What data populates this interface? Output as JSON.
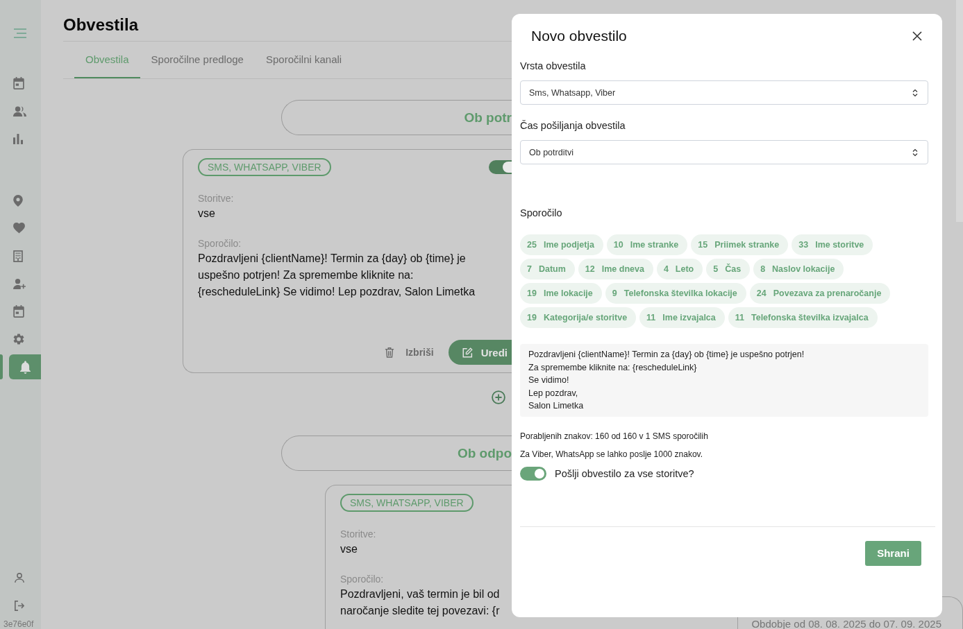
{
  "sidebar": {
    "groups": [
      {
        "items": [
          {
            "selected": false
          },
          {
            "selected": false
          },
          {
            "selected": false
          }
        ]
      },
      {
        "items": [
          {
            "selected": false
          },
          {
            "selected": false
          },
          {
            "selected": false
          },
          {
            "selected": false
          },
          {
            "selected": false
          },
          {
            "selected": false
          },
          {
            "selected": true
          }
        ]
      }
    ],
    "version": "3e76e0f"
  },
  "page": {
    "title": "Obvestila",
    "tabs": [
      {
        "label": "Obvestila",
        "selected": true
      },
      {
        "label": "Sporočilne predloge",
        "selected": false
      },
      {
        "label": "Sporočilni kanali",
        "selected": false
      }
    ]
  },
  "timeline": [
    {
      "heading": "Ob potr",
      "notifications": [
        {
          "channels": "SMS, WHATSAPP, VIBER",
          "enabled": true,
          "services_label": "Storitve:",
          "services": "vse",
          "message_label": "Sporočilo:",
          "message": "Pozdravljeni {clientName}! Termin za {day} ob {time} je uspešno potrjen! Za spremembe kliknite na: {rescheduleLink} Se vidimo! Lep pozdrav, Salon Limetka",
          "actions": {
            "delete": "Izbriši",
            "edit": "Uredi"
          }
        }
      ]
    },
    {
      "heading": "Ob odpo",
      "notifications": [
        {
          "channels": "SMS, WHATSAPP, VIBER",
          "services_label": "Storitve:",
          "services": "vse",
          "message_label": "Sporočilo:",
          "message": "Pozdravljeni, vaš termin je bil od\nnaročanje sledite tej povezavi: {r"
        }
      ]
    }
  ],
  "summary": {
    "period": "Obdobje od 08. 08. 2025 do 07. 09. 2025"
  },
  "dialog": {
    "title": "Novo obvestilo",
    "fields": [
      {
        "label": "Vrsta obvestila",
        "value": "Sms, Whatsapp, Viber"
      },
      {
        "label": "Čas pošiljanja obvestila",
        "value": "Ob potrditvi"
      }
    ],
    "message_label": "Sporočilo",
    "variables": [
      {
        "count": "25",
        "label": "Ime podjetja"
      },
      {
        "count": "10",
        "label": "Ime stranke"
      },
      {
        "count": "15",
        "label": "Priimek stranke"
      },
      {
        "count": "33",
        "label": "Ime storitve"
      },
      {
        "count": "7",
        "label": "Datum"
      },
      {
        "count": "12",
        "label": "Ime dneva"
      },
      {
        "count": "4",
        "label": "Leto"
      },
      {
        "count": "5",
        "label": "Čas"
      },
      {
        "count": "8",
        "label": "Naslov lokacije"
      },
      {
        "count": "19",
        "label": "Ime lokacije"
      },
      {
        "count": "9",
        "label": "Telefonska številka lokacije"
      },
      {
        "count": "24",
        "label": "Povezava za prenaročanje"
      },
      {
        "count": "19",
        "label": "Kategorija/e storitve"
      },
      {
        "count": "11",
        "label": "Ime izvajalca"
      },
      {
        "count": "11",
        "label": "Telefonska številka izvajalca"
      }
    ],
    "message": "Pozdravljeni {clientName}! Termin za {day} ob {time} je uspešno potrjen!\nZa spremembe kliknite na: {rescheduleLink}\nSe vidimo!\nLep pozdrav,\nSalon Limetka",
    "char_usage": "Porabljenih znakov: 160 od 160 v 1 SMS sporočilih",
    "viber_note": "Za Viber, WhatsApp se lahko poslje 1000 znakov.",
    "all_services": {
      "label": "Pošlji obvestilo za vse storitve?",
      "on": true
    },
    "save_label": "Shrani"
  }
}
